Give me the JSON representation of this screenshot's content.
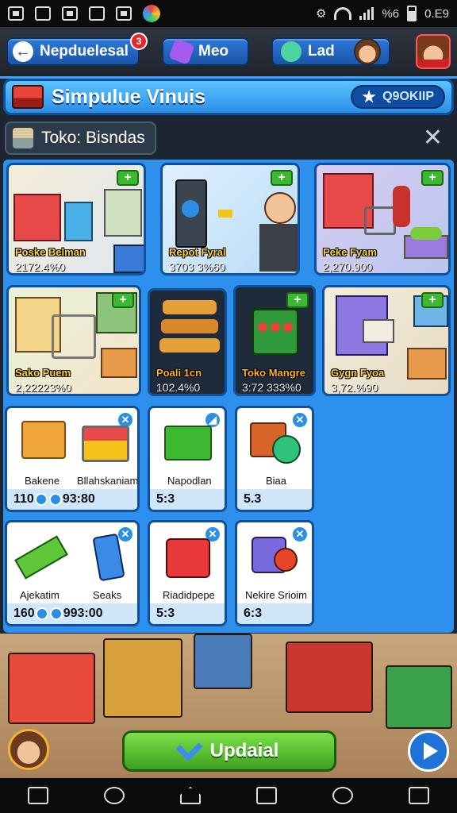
{
  "status_bar": {
    "time": "0.E9",
    "signal": "%6"
  },
  "top_nav": {
    "back_label": "Nepduelesal",
    "back_badge": "3",
    "tab2_label": "Meo",
    "tab3_label": "Lad"
  },
  "header": {
    "title": "Simpulue Vinuis",
    "redeem_label": "Q9OKIIP"
  },
  "section": {
    "label": "Toko: Bisndas"
  },
  "shops": [
    {
      "name": "Poske Belman",
      "value": "2172.4%0"
    },
    {
      "name": "Repot Fyral",
      "value": "3703 3%60"
    },
    {
      "name": "Peke Fyam",
      "value": "2,270.900"
    },
    {
      "name": "Sako Puem",
      "value": "2,22223%0"
    },
    {
      "name": "Poali 1cn",
      "value": "102.4%0"
    },
    {
      "name": "Toko Mangre",
      "value": "3:72 333%0"
    },
    {
      "name": "Gygn Fyoa",
      "value": "3,72.%90"
    }
  ],
  "items": [
    {
      "labels": [
        "Bakene",
        "Bllahskaniam"
      ],
      "footer": "110",
      "footer_tail": "93:80"
    },
    {
      "labels": [
        "Napodlan"
      ],
      "footer": "5:3"
    },
    {
      "labels": [
        "Biaa"
      ],
      "footer": "5.3"
    },
    {
      "labels": [
        "Ajekatim",
        "Seaks"
      ],
      "footer": "160",
      "footer_tail": "993:00"
    },
    {
      "labels": [
        "Riadidpepe"
      ],
      "footer": "5:3"
    },
    {
      "labels": [
        "Nekire Srioim"
      ],
      "footer": "6:3"
    }
  ],
  "action": {
    "update_label": "Updaial"
  },
  "colors": {
    "accent": "#2b8fe6",
    "update_green": "#3ea11f",
    "plus_green": "#3cb832",
    "badge_red": "#e8262a"
  }
}
